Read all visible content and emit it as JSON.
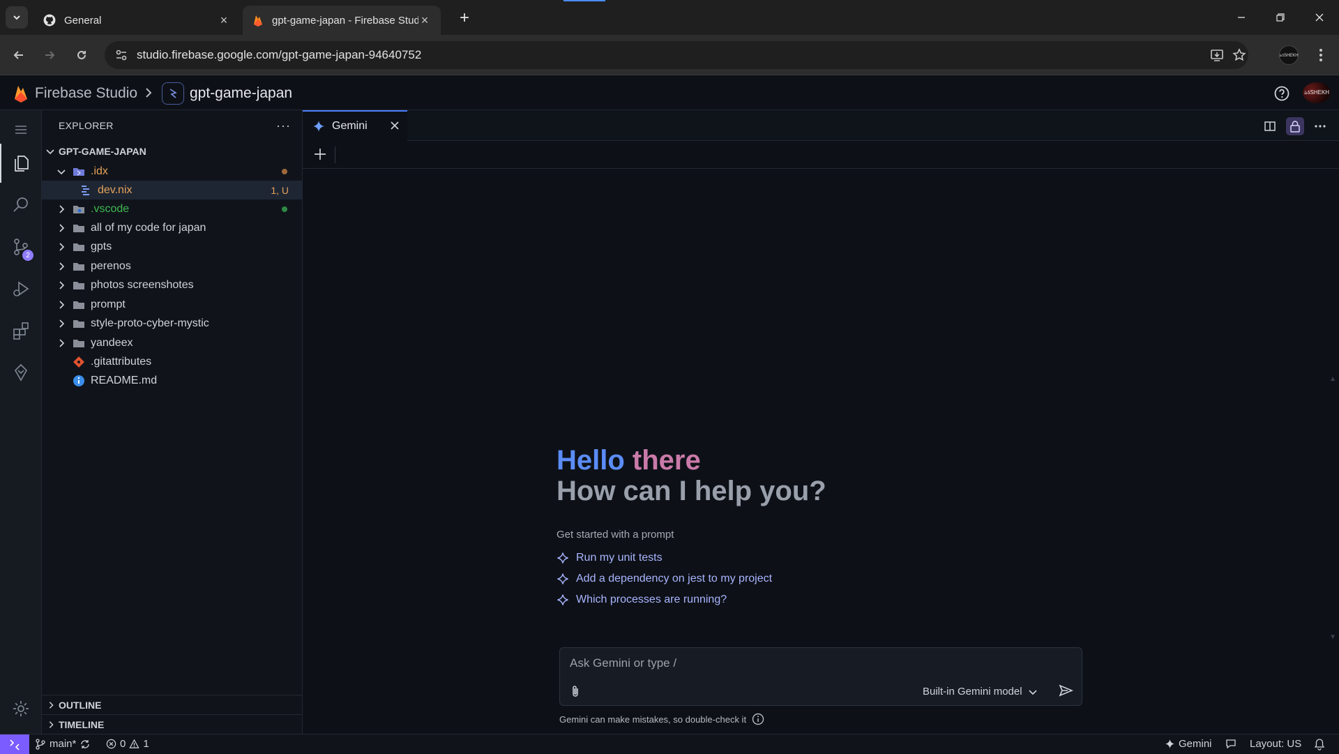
{
  "browser": {
    "tabs": [
      {
        "title": "General",
        "icon": "github-icon"
      },
      {
        "title": "gpt-game-japan - Firebase Studio",
        "icon": "firebase-icon",
        "active": true
      }
    ],
    "url": "studio.firebase.google.com/gpt-game-japan-94640752",
    "profile_text": "ঌऽSHEKH"
  },
  "header": {
    "brand": "Firebase Studio",
    "project": "gpt-game-japan",
    "avatar_text": "ঌऽSHEKH"
  },
  "activity": {
    "items": [
      "explorer-icon",
      "search-icon",
      "source-control-icon",
      "run-debug-icon",
      "extensions-icon",
      "firebase-studio-icon",
      "settings-gear-icon"
    ],
    "source_control_badge": "2"
  },
  "explorer": {
    "title": "EXPLORER",
    "root": "GPT-GAME-JAPAN",
    "items": [
      {
        "label": ".idx",
        "status": "",
        "color": "#e6a15a"
      },
      {
        "label": "dev.nix",
        "status": "1, U",
        "color": "#e6a15a"
      },
      {
        "label": ".vscode",
        "status": "",
        "color": "#3fb950"
      },
      {
        "label": "all of my code for japan"
      },
      {
        "label": "gpts"
      },
      {
        "label": "perenos"
      },
      {
        "label": "photos screenshotes"
      },
      {
        "label": "prompt"
      },
      {
        "label": "style-proto-cyber-mystic"
      },
      {
        "label": "yandeex"
      },
      {
        "label": ".gitattributes"
      },
      {
        "label": "README.md"
      }
    ],
    "sections": {
      "outline": "OUTLINE",
      "timeline": "TIMELINE"
    }
  },
  "editor": {
    "tab": "Gemini",
    "greeting_hello": "Hello",
    "greeting_there": "there",
    "greeting_sub": "How can I help you?",
    "get_started": "Get started with a prompt",
    "suggestions": [
      "Run my unit tests",
      "Add a dependency on jest to my project",
      "Which processes are running?"
    ],
    "chat_placeholder": "Ask Gemini or type /",
    "model": "Built-in Gemini model",
    "disclaimer": "Gemini can make mistakes, so double-check it"
  },
  "statusbar": {
    "branch": "main*",
    "errors": "0",
    "warnings": "1",
    "gemini": "Gemini",
    "layout": "Layout: US"
  },
  "colors": {
    "accent": "#7a5cff",
    "gemini_blue": "#5b8cf7",
    "suggestion": "#a9b4ff"
  }
}
